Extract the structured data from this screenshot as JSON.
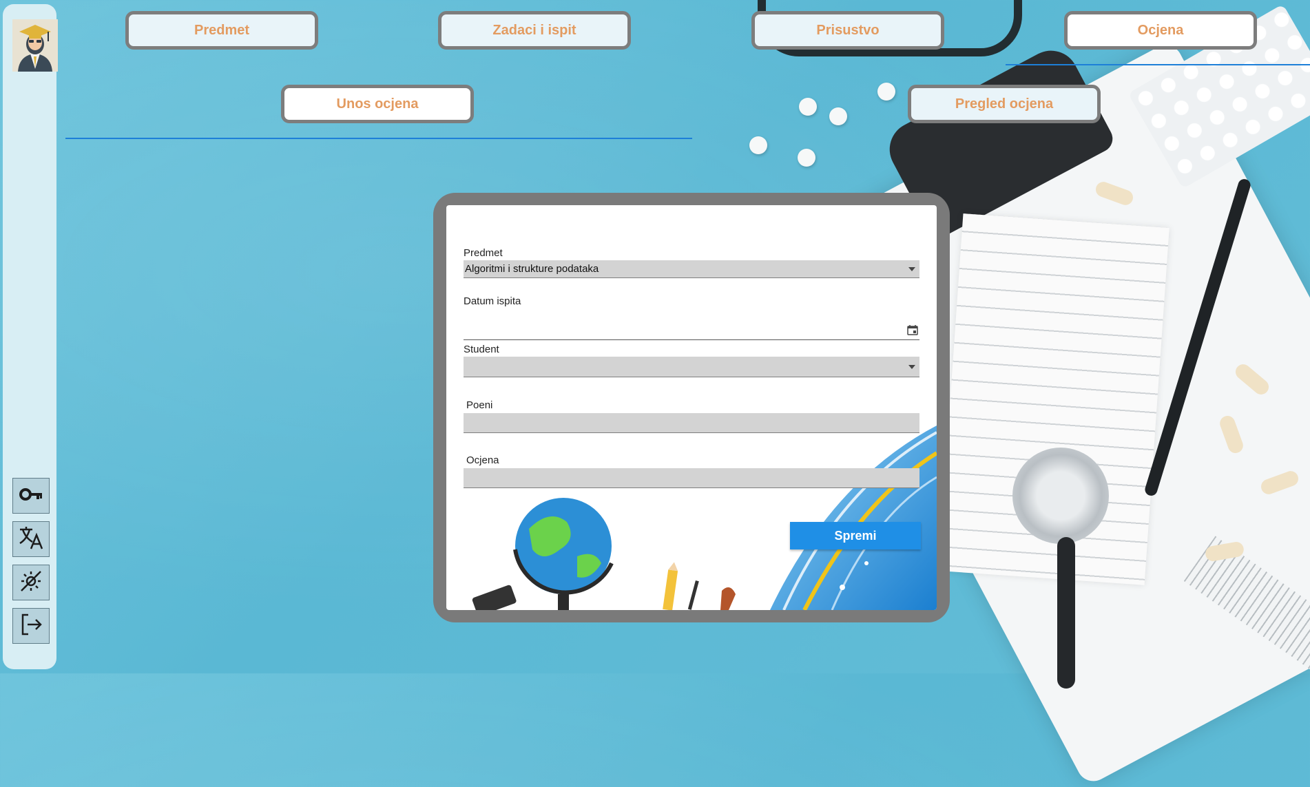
{
  "nav": {
    "tabs": [
      {
        "label": "Predmet",
        "active": false
      },
      {
        "label": "Zadaci i ispit",
        "active": false
      },
      {
        "label": "Prisustvo",
        "active": false
      },
      {
        "label": "Ocjena",
        "active": true
      }
    ],
    "subtabs": [
      {
        "label": "Unos ocjena",
        "active": true
      },
      {
        "label": "Pregled ocjena",
        "active": false
      }
    ]
  },
  "sidebar": {
    "icons": [
      "graduate-avatar-icon",
      "key-icon",
      "translate-icon",
      "theme-toggle-icon",
      "logout-icon"
    ]
  },
  "form": {
    "predmet_label": "Predmet",
    "predmet_value": "Algoritmi i strukture podataka",
    "datum_label": "Datum ispita",
    "datum_value": "",
    "student_label": "Student",
    "student_value": "",
    "poeni_label": "Poeni",
    "poeni_value": "",
    "ocjena_label": "Ocjena",
    "ocjena_value": "",
    "save_label": "Spremi"
  },
  "colors": {
    "tab_text": "#e39b60",
    "accent_blue": "#1f8fe6",
    "underline": "#1d7fd8",
    "border_gray": "#7d7d7d"
  }
}
